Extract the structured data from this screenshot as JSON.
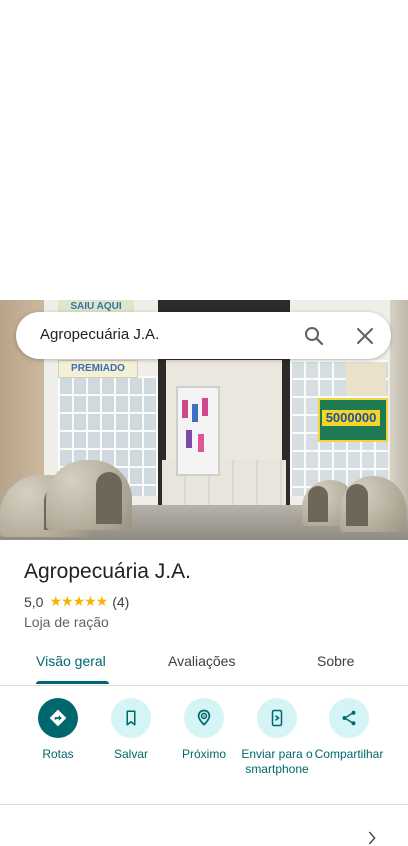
{
  "search": {
    "query": "Agropecuária J.A."
  },
  "photo": {
    "sign_top": "SAIU AQUI",
    "sign_premiado": "PREMIADO",
    "poster_number": "5000000"
  },
  "place": {
    "name": "Agropecuária J.A.",
    "rating": "5,0",
    "stars": "★★★★★",
    "review_count": "(4)",
    "category": "Loja de ração"
  },
  "tabs": [
    {
      "label": "Visão geral",
      "active": true
    },
    {
      "label": "Avaliações",
      "active": false
    },
    {
      "label": "Sobre",
      "active": false
    }
  ],
  "actions": [
    {
      "label": "Rotas",
      "icon": "directions-icon"
    },
    {
      "label": "Salvar",
      "icon": "bookmark-icon"
    },
    {
      "label": "Próximo",
      "icon": "nearby-icon"
    },
    {
      "label": "Enviar para o smartphone",
      "icon": "send-to-phone-icon"
    },
    {
      "label": "Compartilhar",
      "icon": "share-icon"
    }
  ],
  "colors": {
    "accent": "#00676f",
    "accent_light": "#d4f4f6",
    "star": "#f6b400"
  }
}
